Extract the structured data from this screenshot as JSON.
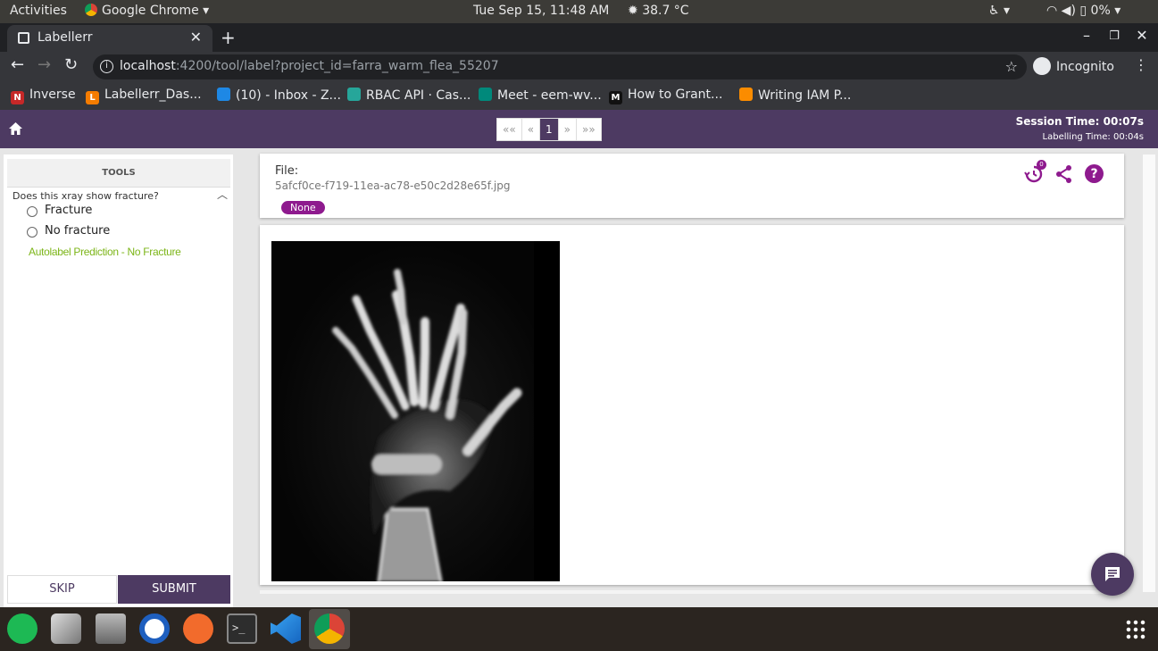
{
  "system_bar": {
    "activities": "Activities",
    "app_name": "Google Chrome",
    "clock": "Tue Sep 15, 11:48 AM",
    "weather": "38.7 °C",
    "battery": "0%"
  },
  "browser": {
    "tab_title": "Labellerr",
    "url_host": "localhost",
    "url_path": ":4200/tool/label?project_id=farra_warm_flea_55207",
    "profile": "Incognito",
    "bookmarks": [
      {
        "label": "Inverse",
        "color": "#c62828",
        "glyph": "N"
      },
      {
        "label": "Labellerr_Das...",
        "color": "#f57c00",
        "glyph": "L"
      },
      {
        "label": "(10) - Inbox - Z...",
        "color": "#1e88e5",
        "glyph": ""
      },
      {
        "label": "RBAC API · Cas...",
        "color": "#26a69a",
        "glyph": ""
      },
      {
        "label": "Meet - eem-wv...",
        "color": "#00897b",
        "glyph": ""
      },
      {
        "label": "How to Grant...",
        "color": "#111111",
        "glyph": "M"
      },
      {
        "label": "Writing IAM P...",
        "color": "#fb8c00",
        "glyph": ""
      }
    ]
  },
  "app": {
    "pager": {
      "first": "««",
      "prev": "«",
      "current": "1",
      "next": "»",
      "last": "»»"
    },
    "session_time": "Session Time: 00:07s",
    "labelling_time": "Labelling Time: 00:04s",
    "tools_title": "TOOLS",
    "question": "Does this xray show fracture?",
    "options": [
      "Fracture",
      "No fracture"
    ],
    "autolabel": "Autolabel Prediction - No Fracture",
    "skip": "SKIP",
    "submit": "SUBMIT",
    "file_label": "File:",
    "file_name": "5afcf0ce-f719-11ea-ac78-e50c2d28e65f.jpg",
    "status_badge": "None",
    "history_count": "0"
  }
}
